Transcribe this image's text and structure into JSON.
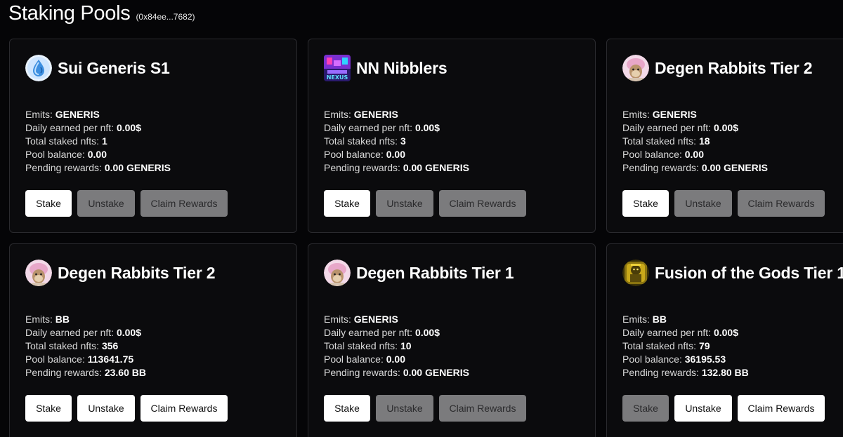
{
  "header": {
    "title": "Staking Pools",
    "wallet": "(0x84ee...7682)"
  },
  "labels": {
    "emits": "Emits:",
    "daily": "Daily earned per nft:",
    "total": "Total staked nfts:",
    "balance": "Pool balance:",
    "pending": "Pending rewards:"
  },
  "pools": [
    {
      "name": "Sui Generis S1",
      "icon": "water-drop-icon",
      "emits": "GENERIS",
      "daily": "0.00$",
      "total_staked": "1",
      "pool_balance": "0.00",
      "pending": "0.00 GENERIS",
      "buttons": {
        "stake": "Stake",
        "unstake": "Unstake",
        "claim": "Claim Rewards"
      },
      "enabled": {
        "stake": true,
        "unstake": false,
        "claim": false
      }
    },
    {
      "name": "NN Nibblers",
      "icon": "nexus-logo-icon",
      "emits": "GENERIS",
      "daily": "0.00$",
      "total_staked": "3",
      "pool_balance": "0.00",
      "pending": "0.00 GENERIS",
      "buttons": {
        "stake": "Stake",
        "unstake": "Unstake",
        "claim": "Claim Rewards"
      },
      "enabled": {
        "stake": true,
        "unstake": false,
        "claim": false
      }
    },
    {
      "name": "Degen Rabbits Tier 2",
      "icon": "rabbit-avatar-icon",
      "emits": "GENERIS",
      "daily": "0.00$",
      "total_staked": "18",
      "pool_balance": "0.00",
      "pending": "0.00 GENERIS",
      "buttons": {
        "stake": "Stake",
        "unstake": "Unstake",
        "claim": "Claim Rewards"
      },
      "enabled": {
        "stake": true,
        "unstake": false,
        "claim": false
      }
    },
    {
      "name": "Degen Rabbits Tier 2",
      "icon": "rabbit-avatar-icon",
      "emits": "BB",
      "daily": "0.00$",
      "total_staked": "356",
      "pool_balance": "113641.75",
      "pending": "23.60 BB",
      "buttons": {
        "stake": "Stake",
        "unstake": "Unstake",
        "claim": "Claim Rewards"
      },
      "enabled": {
        "stake": true,
        "unstake": true,
        "claim": true
      }
    },
    {
      "name": "Degen Rabbits Tier 1",
      "icon": "rabbit-avatar-icon",
      "emits": "GENERIS",
      "daily": "0.00$",
      "total_staked": "10",
      "pool_balance": "0.00",
      "pending": "0.00 GENERIS",
      "buttons": {
        "stake": "Stake",
        "unstake": "Unstake",
        "claim": "Claim Rewards"
      },
      "enabled": {
        "stake": true,
        "unstake": false,
        "claim": false
      }
    },
    {
      "name": "Fusion of the Gods Tier 1",
      "icon": "golden-god-icon",
      "emits": "BB",
      "daily": "0.00$",
      "total_staked": "79",
      "pool_balance": "36195.53",
      "pending": "132.80 BB",
      "buttons": {
        "stake": "Stake",
        "unstake": "Unstake",
        "claim": "Claim Rewards"
      },
      "enabled": {
        "stake": false,
        "unstake": true,
        "claim": true
      }
    }
  ]
}
